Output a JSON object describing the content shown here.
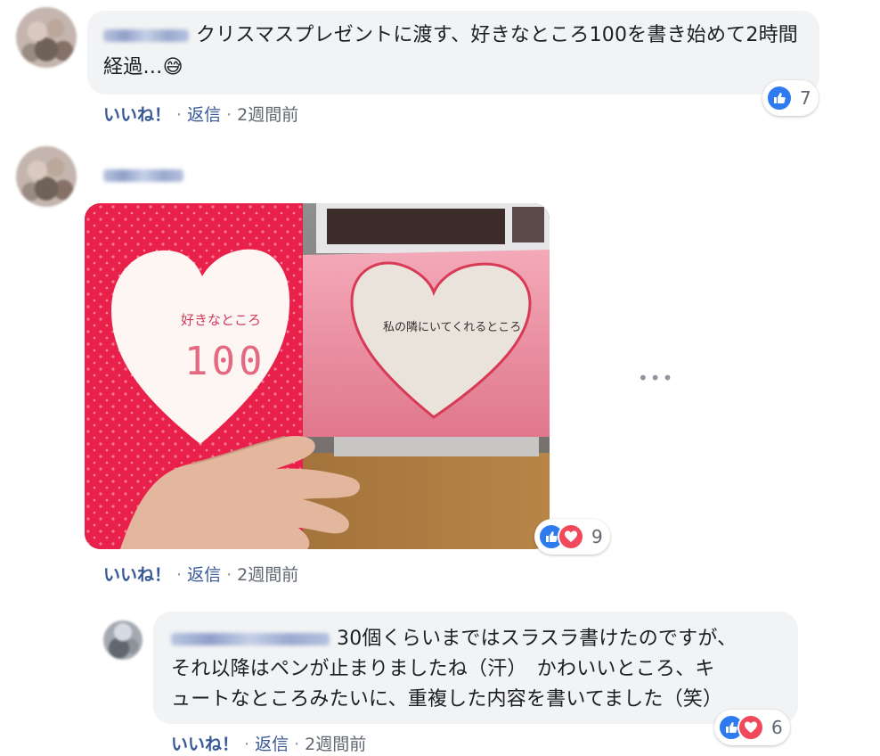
{
  "comments": [
    {
      "text": "クリスマスプレゼントに渡す、好きなところ100を書き始めて2時間経過…",
      "emoji": "😅",
      "reaction_count": "7",
      "like_label": "いいね！",
      "reply_label": "返信",
      "time": "2週間前"
    },
    {
      "photo": {
        "cover_title": "好きなところ",
        "cover_number": "100",
        "page_text": "私の隣にいてくれるところ"
      },
      "reaction_count": "9",
      "like_label": "いいね！",
      "reply_label": "返信",
      "time": "2週間前"
    }
  ],
  "reply": {
    "line1": "30個くらいまではスラスラ書けたのですが、",
    "line2": "それ以降はペンが止まりましたね（汗）　かわいいところ、キ",
    "line3": "ュートなところみたいに、重複した内容を書いてました（笑）",
    "reaction_count": "6",
    "like_label": "いいね！",
    "reply_label": "返信",
    "time": "2週間前"
  },
  "more_icon": "more-horizontal-icon",
  "colors": {
    "bubble": "#f2f3f5",
    "link": "#385898",
    "like_blue": "#2e7bf0",
    "love_red": "#f0495c"
  }
}
